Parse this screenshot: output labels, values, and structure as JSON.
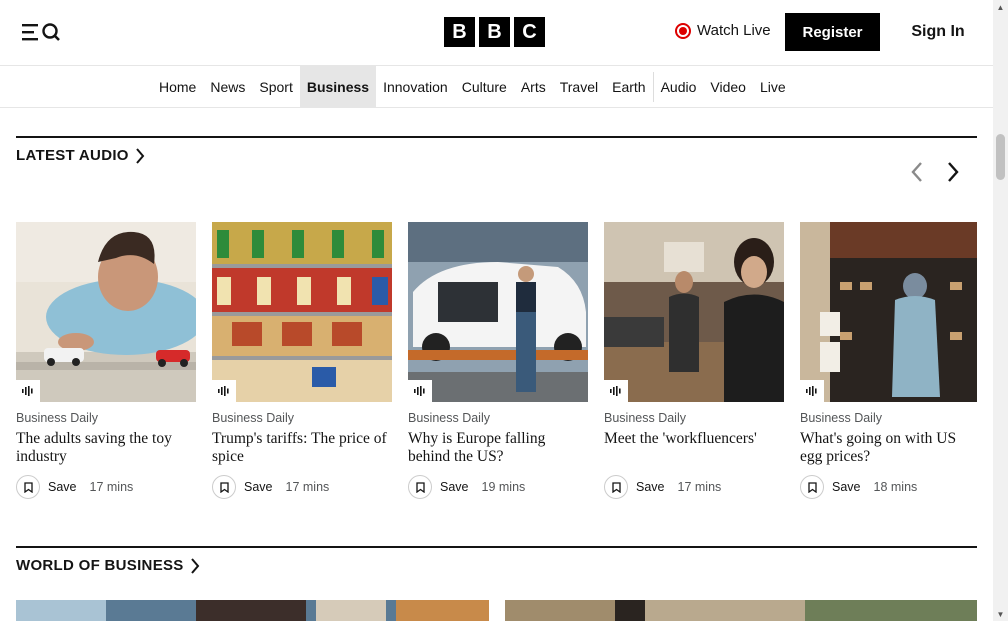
{
  "header": {
    "logo_letters": [
      "B",
      "B",
      "C"
    ],
    "watch_live_label": "Watch Live",
    "register_label": "Register",
    "signin_label": "Sign In"
  },
  "nav": {
    "items": [
      "Home",
      "News",
      "Sport",
      "Business",
      "Innovation",
      "Culture",
      "Arts",
      "Travel",
      "Earth",
      "Audio",
      "Video",
      "Live"
    ],
    "active": "Business"
  },
  "latest_audio": {
    "title": "LATEST AUDIO",
    "cards": [
      {
        "source": "Business Daily",
        "title": "The adults saving the toy industry",
        "save_label": "Save",
        "duration": "17 mins"
      },
      {
        "source": "Business Daily",
        "title": "Trump's tariffs: The price of spice",
        "save_label": "Save",
        "duration": "17 mins"
      },
      {
        "source": "Business Daily",
        "title": "Why is Europe falling behind the US?",
        "save_label": "Save",
        "duration": "19 mins"
      },
      {
        "source": "Business Daily",
        "title": "Meet the 'workfluencers'",
        "save_label": "Save",
        "duration": "17 mins"
      },
      {
        "source": "Business Daily",
        "title": "What's going on with US egg prices?",
        "save_label": "Save",
        "duration": "18 mins"
      }
    ]
  },
  "world_of_business": {
    "title": "WORLD OF BUSINESS"
  },
  "colors": {
    "live_red": "#d00000",
    "text": "#141414",
    "active_nav_bg": "#e6e6e6"
  },
  "icons": [
    "menu-icon",
    "search-icon",
    "live-dot-icon",
    "chevron-right-icon",
    "chevron-left-icon",
    "audio-wave-icon",
    "bookmark-icon"
  ]
}
